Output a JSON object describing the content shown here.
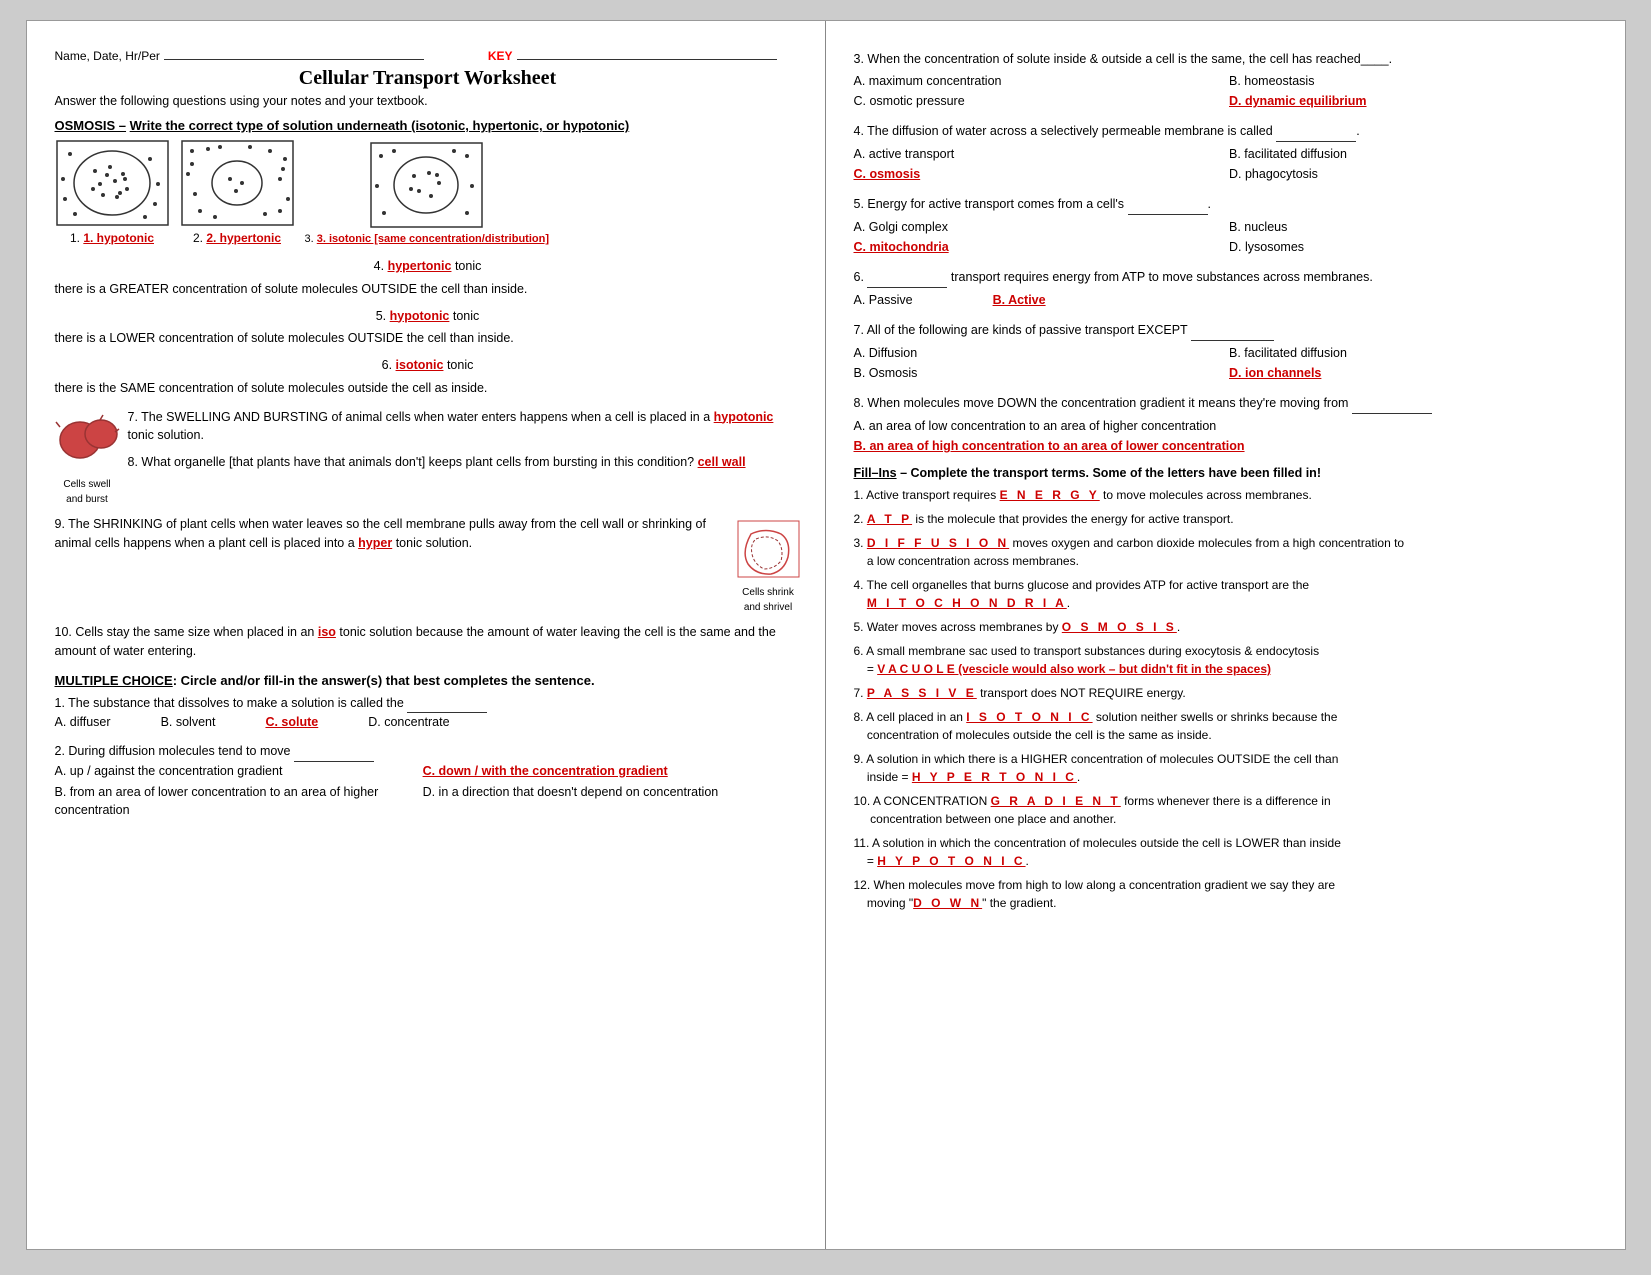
{
  "left": {
    "name_label": "Name, Date, Hr/Per",
    "key_label": "KEY",
    "title": "Cellular Transport Worksheet",
    "subtitle": "Answer the following questions using your notes and your textbook.",
    "osmosis_header": "OSMOSIS –",
    "osmosis_instruction": " Write the correct type of solution underneath (isotonic, hypertonic, or hypotonic)",
    "diagram1_label": "1. hypotonic",
    "diagram2_label": "2. hypertonic",
    "diagram3_label": "3. isotonic [same concentration/distribution]",
    "q4_text": "4.",
    "q4_answer": "hypertonic",
    "q4_rest": "tonic",
    "q4_detail": "there is a GREATER concentration of solute molecules OUTSIDE the cell than inside.",
    "q5_text": "5.",
    "q5_answer": "hypotonic",
    "q5_rest": "tonic",
    "q5_detail": "there is a LOWER concentration of solute molecules OUTSIDE the cell than inside.",
    "q6_text": "6.",
    "q6_answer": "isotonic",
    "q6_rest": "tonic",
    "q6_detail": "there is the SAME concentration of solute molecules outside the cell as inside.",
    "q7_text": "7. The SWELLING AND BURSTING of animal cells when water enters happens when a cell is placed in a",
    "q7_answer": "hypotonic",
    "q7_end": "tonic solution.",
    "cells_swell_label": "Cells swell\nand burst",
    "q8_text": "8. What organelle [that plants have that animals don't] keeps plant cells from bursting in this condition?",
    "q8_answer": "cell wall",
    "q9_text": "9. The SHRINKING of plant cells when water leaves so the cell membrane pulls away from the cell wall or shrinking of animal cells happens when a plant cell is placed into a",
    "q9_answer": "hyper",
    "q9_end": "tonic solution.",
    "cells_shrink_label": "Cells shrink\nand shrivel",
    "q10_text": "10. Cells stay the same size when placed in an",
    "q10_answer": "iso",
    "q10_end": "tonic solution because the amount of water leaving the cell is the same and the amount of water entering.",
    "mc_header": "MULTIPLE CHOICE",
    "mc_instruction": ": Circle and/or fill-in the answer(s) that best completes the sentence.",
    "mc1_q": "1. The substance that dissolves to make a solution is called the",
    "mc1_a": "A. diffuser",
    "mc1_b": "B. solvent",
    "mc1_c": "C. solute",
    "mc1_d": "D. concentrate",
    "mc2_q": "2. During diffusion molecules tend to move",
    "mc2_a_label": "A. up / against the concentration gradient",
    "mc2_b_label": "B.  from an area of lower concentration to an area of higher concentration",
    "mc2_c_label": "C. down / with the concentration gradient",
    "mc2_d_label": "D. in a direction that doesn't depend on concentration"
  },
  "right": {
    "q3_text": "3. When the concentration of solute inside & outside a cell is the same, the cell has reached",
    "q3_blank": "____",
    "q3_a": "A. maximum concentration",
    "q3_b": "B. homeostasis",
    "q3_c": "C. osmotic pressure",
    "q3_d": "D. dynamic equilibrium",
    "q4_text": "4. The diffusion of water across a selectively permeable membrane is called",
    "q4_blank": "________________",
    "q4_a": "A. active transport",
    "q4_b": "B. facilitated diffusion",
    "q4_c": "C. osmosis",
    "q4_d": "D. phagocytosis",
    "q5_text": "5. Energy for active transport comes from a cell's",
    "q5_blank": "__________________",
    "q5_a": "A. Golgi complex",
    "q5_b": "B. nucleus",
    "q5_c": "C. mitochondria",
    "q5_d": "D. lysosomes",
    "q6_text": "6.",
    "q6_blank": "_______________",
    "q6_rest": "transport requires energy from ATP to move substances across membranes.",
    "q6_a": "A. Passive",
    "q6_b": "B. Active",
    "q7_text": "7. All of the following are kinds of passive transport EXCEPT",
    "q7_blank": "__________________________",
    "q7_a": "A.  Diffusion",
    "q7_b": "B.  facilitated diffusion",
    "q7_c": "B.  Osmosis",
    "q7_d": "D. ion channels",
    "q8_text": "8. When molecules move DOWN the concentration gradient it means they're moving from",
    "q8_blank": "_____",
    "q8_a": "A. an area of low concentration to an area of higher concentration",
    "q8_b": "B. an area of high concentration to an area of lower concentration",
    "fill_header": "Fill–Ins",
    "fill_instruction": "– Complete the transport terms. Some of the letters have been filled in!",
    "fill1": "1. Active transport requires _E N E R G Y_ to move molecules across membranes.",
    "fill2": "2. _A T P_ is the molecule that provides the energy for active transport.",
    "fill3": "3. _D I F F U S I O N_ moves oxygen and carbon dioxide molecules from a high concentration to a low concentration across membranes.",
    "fill4_pre": "4. The cell organelles that burns glucose and provides ATP for active transport are the",
    "fill4_ans": "_M I T O C H O N D R I A_.",
    "fill5_pre": "5. Water moves across membranes by _O S M O S I S_.",
    "fill6_pre": "6. A small membrane sac used to transport substances during exocytosis & endocytosis",
    "fill6_ans": "= _V A C U O L E (vescicle would also work – but didn't fit in the spaces)",
    "fill7": "7. _P A S S I V E_ transport does NOT REQUIRE energy.",
    "fill8_pre": "8. A cell placed in an _I S O T O N I C_ solution neither swells or shrinks because the concentration of molecules outside the cell is the same as inside.",
    "fill9_pre": "9. A solution in which there is a HIGHER concentration of molecules OUTSIDE the cell than inside  = _H Y P E R T O N I C_.",
    "fill10_pre": "10. A CONCENTRATION _G R A D I E N T_ forms whenever there is a difference in concentration between one place and another.",
    "fill11_pre": "11. A solution in which the concentration of molecules outside the cell is LOWER than inside = _H Y P O T O N I C_.",
    "fill12_pre": "12. When molecules move from high to low along a concentration gradient we say they are moving \"D O W N\" the gradient."
  }
}
